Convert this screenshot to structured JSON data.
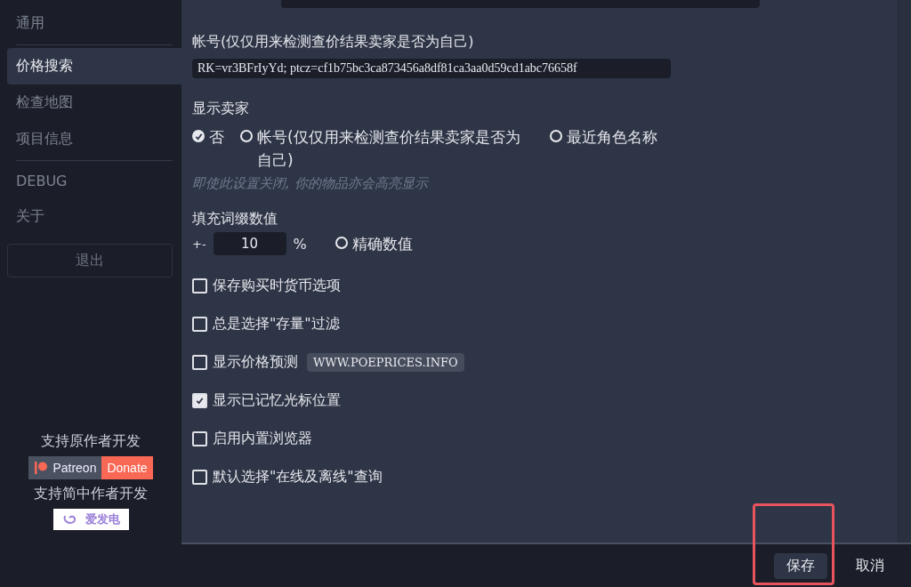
{
  "sidebar": {
    "items": [
      {
        "label": "通用",
        "selected": false,
        "kind": "item"
      },
      {
        "kind": "divider"
      },
      {
        "label": "价格搜索",
        "selected": true,
        "kind": "item"
      },
      {
        "label": "检查地图",
        "selected": false,
        "kind": "item"
      },
      {
        "label": "项目信息",
        "selected": false,
        "kind": "item"
      },
      {
        "kind": "divider"
      },
      {
        "label": "DEBUG",
        "selected": false,
        "kind": "item"
      },
      {
        "label": "关于",
        "selected": false,
        "kind": "item"
      }
    ],
    "logout": "退出",
    "support_original": "支持原作者开发",
    "patreon": "Patreon",
    "donate": "Donate",
    "support_cn": "支持简中作者开发",
    "afdian": "爱发电"
  },
  "league_field": {
    "kind": "cut_field"
  },
  "account": {
    "label": "帐号(仅仅用来检测查价结果卖家是否为自己)",
    "value": "RK=vr3BFrIyYd; ptcz=cf1b75bc3ca873456a8df81ca3aa0d59cd1abc76658f"
  },
  "show_seller": {
    "label": "显示卖家",
    "options": [
      {
        "label": "否",
        "selected": true
      },
      {
        "label": "帐号(仅仅用来检测查价结果卖家是否为自己)",
        "selected": false
      },
      {
        "label": "最近角色名称",
        "selected": false
      }
    ],
    "hint": "即使此设置关闭, 你的物品亦会高亮显示"
  },
  "fill_mods": {
    "label": "填充词缀数值",
    "prefix": "+-",
    "value": "10",
    "unit": "%",
    "exact": {
      "label": "精确数值",
      "selected": false
    }
  },
  "checkboxes": [
    {
      "label": "保存购买时货币选项",
      "checked": false
    },
    {
      "label": "总是选择\"存量\"过滤",
      "checked": false
    },
    {
      "label": "显示价格预测",
      "checked": false,
      "tag": "WWW.POEPRICES.INFO"
    },
    {
      "label": "显示已记忆光标位置",
      "checked": true
    },
    {
      "label": "启用内置浏览器",
      "checked": false
    },
    {
      "label": "默认选择\"在线及离线\"查询",
      "checked": false
    }
  ],
  "footer": {
    "buttons": [
      {
        "label": "保存",
        "kind": "primary",
        "highlighted": true
      },
      {
        "label": "取消",
        "kind": "plain",
        "highlighted": false
      }
    ]
  }
}
